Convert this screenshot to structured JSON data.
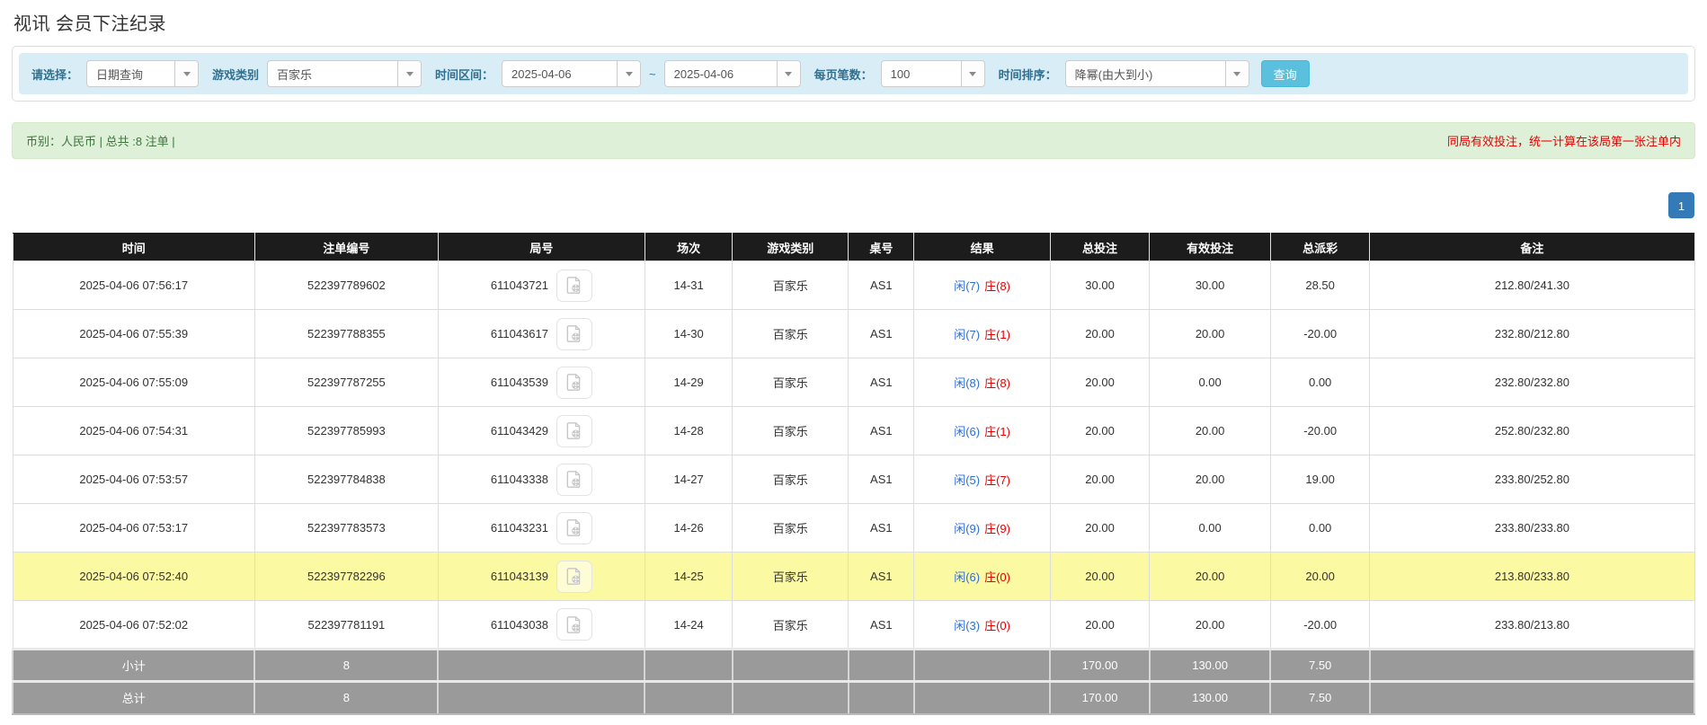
{
  "page_title": "视讯 会员下注纪录",
  "filters": {
    "select_type": {
      "label": "请选择：",
      "value": "日期查询"
    },
    "game_category": {
      "label": "游戏类别",
      "value": "百家乐"
    },
    "time_range": {
      "label": "时间区间：",
      "from": "2025-04-06",
      "separator": "~",
      "to": "2025-04-06"
    },
    "page_size": {
      "label": "每页笔数：",
      "value": "100"
    },
    "time_order": {
      "label": "时间排序：",
      "value": "降幂(由大到小)"
    },
    "query_button_label": "查询"
  },
  "summary_bar": {
    "left_text": "币别：人民币 | 总共 :8 注单 |",
    "right_note": "同局有效投注，统一计算在该局第一张注单内"
  },
  "pagination": {
    "current_page": "1"
  },
  "table": {
    "headers": [
      "时间",
      "注单编号",
      "局号",
      "场次",
      "游戏类别",
      "桌号",
      "结果",
      "总投注",
      "有效投注",
      "总派彩",
      "备注"
    ],
    "rows": [
      {
        "time": "2025-04-06 07:56:17",
        "bet_id": "522397789602",
        "round_id": "611043721",
        "session": "14-31",
        "game": "百家乐",
        "table_no": "AS1",
        "result_player": "闲(7)",
        "result_banker": "庄(8)",
        "total_bet": "30.00",
        "valid_bet": "30.00",
        "payout": "28.50",
        "note": "212.80/241.30",
        "highlight": false
      },
      {
        "time": "2025-04-06 07:55:39",
        "bet_id": "522397788355",
        "round_id": "611043617",
        "session": "14-30",
        "game": "百家乐",
        "table_no": "AS1",
        "result_player": "闲(7)",
        "result_banker": "庄(1)",
        "total_bet": "20.00",
        "valid_bet": "20.00",
        "payout": "-20.00",
        "note": "232.80/212.80",
        "highlight": false
      },
      {
        "time": "2025-04-06 07:55:09",
        "bet_id": "522397787255",
        "round_id": "611043539",
        "session": "14-29",
        "game": "百家乐",
        "table_no": "AS1",
        "result_player": "闲(8)",
        "result_banker": "庄(8)",
        "total_bet": "20.00",
        "valid_bet": "0.00",
        "payout": "0.00",
        "note": "232.80/232.80",
        "highlight": false
      },
      {
        "time": "2025-04-06 07:54:31",
        "bet_id": "522397785993",
        "round_id": "611043429",
        "session": "14-28",
        "game": "百家乐",
        "table_no": "AS1",
        "result_player": "闲(6)",
        "result_banker": "庄(1)",
        "total_bet": "20.00",
        "valid_bet": "20.00",
        "payout": "-20.00",
        "note": "252.80/232.80",
        "highlight": false
      },
      {
        "time": "2025-04-06 07:53:57",
        "bet_id": "522397784838",
        "round_id": "611043338",
        "session": "14-27",
        "game": "百家乐",
        "table_no": "AS1",
        "result_player": "闲(5)",
        "result_banker": "庄(7)",
        "total_bet": "20.00",
        "valid_bet": "20.00",
        "payout": "19.00",
        "note": "233.80/252.80",
        "highlight": false
      },
      {
        "time": "2025-04-06 07:53:17",
        "bet_id": "522397783573",
        "round_id": "611043231",
        "session": "14-26",
        "game": "百家乐",
        "table_no": "AS1",
        "result_player": "闲(9)",
        "result_banker": "庄(9)",
        "total_bet": "20.00",
        "valid_bet": "0.00",
        "payout": "0.00",
        "note": "233.80/233.80",
        "highlight": false
      },
      {
        "time": "2025-04-06 07:52:40",
        "bet_id": "522397782296",
        "round_id": "611043139",
        "session": "14-25",
        "game": "百家乐",
        "table_no": "AS1",
        "result_player": "闲(6)",
        "result_banker": "庄(0)",
        "total_bet": "20.00",
        "valid_bet": "20.00",
        "payout": "20.00",
        "note": "213.80/233.80",
        "highlight": true
      },
      {
        "time": "2025-04-06 07:52:02",
        "bet_id": "522397781191",
        "round_id": "611043038",
        "session": "14-24",
        "game": "百家乐",
        "table_no": "AS1",
        "result_player": "闲(3)",
        "result_banker": "庄(0)",
        "total_bet": "20.00",
        "valid_bet": "20.00",
        "payout": "-20.00",
        "note": "233.80/213.80",
        "highlight": false
      }
    ],
    "subtotal": {
      "label": "小计",
      "count": "8",
      "total_bet": "170.00",
      "valid_bet": "130.00",
      "total_payout": "7.50"
    },
    "total": {
      "label": "总计",
      "count": "8",
      "total_bet": "170.00",
      "valid_bet": "130.00",
      "total_payout": "7.50"
    }
  },
  "colors": {
    "accent_blue": "#2b6ed9",
    "banker_red": "#e60000",
    "negative_red": "#e60000",
    "note_red": "#e60000",
    "highlight_yellow": "#fbf9a2",
    "header_black": "#1c1c1c",
    "summary_gray": "#9a9a9a",
    "filter_bg": "#d9edf7",
    "success_bg": "#dff0d8",
    "success_text": "#3c763d",
    "button_teal": "#5bc0de",
    "pagination_blue": "#337ab7"
  }
}
